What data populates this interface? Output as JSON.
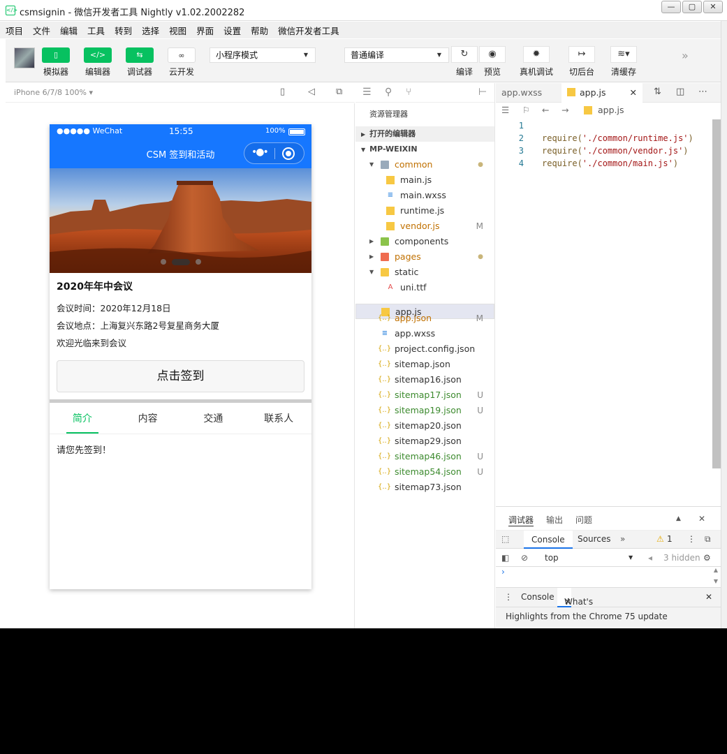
{
  "window": {
    "title": "csmsignin - 微信开发者工具 Nightly v1.02.2002282"
  },
  "menu": [
    "项目",
    "文件",
    "编辑",
    "工具",
    "转到",
    "选择",
    "视图",
    "界面",
    "设置",
    "帮助",
    "微信开发者工具"
  ],
  "toolbar": {
    "simulator": "模拟器",
    "editor": "编辑器",
    "debugger": "调试器",
    "cloud": "云开发",
    "mode": "小程序模式",
    "compile_mode": "普通编译",
    "compile": "编译",
    "preview": "预览",
    "remote_debug": "真机调试",
    "background": "切后台",
    "clear_cache": "清缓存"
  },
  "simulator": {
    "device": "iPhone 6/7/8 100% ▾"
  },
  "phone": {
    "carrier": "●●●●● WeChat",
    "time": "15:55",
    "battery": "100%",
    "nav_title": "CSM 签到和活动",
    "meeting_title": "2020年年中会议",
    "meeting_time": "会议时间：2020年12月18日",
    "meeting_place": "会议地点：上海复兴东路2号复星商务大厦",
    "welcome": "欢迎光临来到会议",
    "sign_button": "点击签到",
    "tabs": [
      "简介",
      "内容",
      "交通",
      "联系人"
    ],
    "active_tab": 0,
    "tab_content": "请您先签到！"
  },
  "explorer": {
    "header": "资源管理器",
    "open_editors": "打开的编辑器",
    "project": "MP-WEIXIN",
    "files": [
      {
        "name": "common",
        "type": "folder",
        "depth": 0,
        "open": true,
        "badge": "●",
        "color": "orange"
      },
      {
        "name": "main.js",
        "type": "js",
        "depth": 1,
        "badge": "",
        "color": ""
      },
      {
        "name": "main.wxss",
        "type": "wxss",
        "depth": 1,
        "badge": "",
        "color": ""
      },
      {
        "name": "runtime.js",
        "type": "js",
        "depth": 1,
        "badge": "",
        "color": ""
      },
      {
        "name": "vendor.js",
        "type": "js",
        "depth": 1,
        "badge": "M",
        "color": "orange"
      },
      {
        "name": "components",
        "type": "folder",
        "depth": 0,
        "open": false,
        "badge": "",
        "color": ""
      },
      {
        "name": "pages",
        "type": "folder",
        "depth": 0,
        "open": false,
        "badge": "●",
        "color": "orange"
      },
      {
        "name": "static",
        "type": "folder",
        "depth": 0,
        "open": true,
        "badge": "",
        "color": ""
      },
      {
        "name": "uni.ttf",
        "type": "ttf",
        "depth": 1,
        "badge": "",
        "color": ""
      },
      {
        "name": "app.js",
        "type": "js",
        "depth": 0,
        "badge": "",
        "color": "",
        "selected": true
      },
      {
        "name": "app.json",
        "type": "json",
        "depth": 0,
        "badge": "M",
        "color": "orange"
      },
      {
        "name": "app.wxss",
        "type": "wxss",
        "depth": 0,
        "badge": "",
        "color": ""
      },
      {
        "name": "project.config.json",
        "type": "json",
        "depth": 0,
        "badge": "",
        "color": ""
      },
      {
        "name": "sitemap.json",
        "type": "json",
        "depth": 0,
        "badge": "",
        "color": ""
      },
      {
        "name": "sitemap16.json",
        "type": "json",
        "depth": 0,
        "badge": "",
        "color": ""
      },
      {
        "name": "sitemap17.json",
        "type": "json",
        "depth": 0,
        "badge": "U",
        "color": "green"
      },
      {
        "name": "sitemap19.json",
        "type": "json",
        "depth": 0,
        "badge": "U",
        "color": "green"
      },
      {
        "name": "sitemap20.json",
        "type": "json",
        "depth": 0,
        "badge": "",
        "color": ""
      },
      {
        "name": "sitemap29.json",
        "type": "json",
        "depth": 0,
        "badge": "",
        "color": ""
      },
      {
        "name": "sitemap46.json",
        "type": "json",
        "depth": 0,
        "badge": "U",
        "color": "green"
      },
      {
        "name": "sitemap54.json",
        "type": "json",
        "depth": 0,
        "badge": "U",
        "color": "green"
      },
      {
        "name": "sitemap73.json",
        "type": "json",
        "depth": 0,
        "badge": "",
        "color": ""
      }
    ]
  },
  "editor": {
    "tabs": [
      "app.wxss",
      "app.js"
    ],
    "active_tab": "app.js",
    "breadcrumb": "app.js",
    "lines": [
      {
        "n": "1",
        "code": ""
      },
      {
        "n": "2",
        "code": "require('./common/runtime.js')"
      },
      {
        "n": "3",
        "code": "require('./common/vendor.js')"
      },
      {
        "n": "4",
        "code": "require('./common/main.js')"
      }
    ]
  },
  "devtools": {
    "panel_tabs": [
      "调试器",
      "输出",
      "问题"
    ],
    "tabs": [
      "Console",
      "Sources"
    ],
    "warnings": "1",
    "context": "top",
    "hidden": "3 hidden",
    "drawer_tabs": [
      "Console",
      "What's New"
    ],
    "whats_new": "Highlights from the Chrome 75 update"
  },
  "colors": {
    "accent": "#07c160",
    "nav_blue": "#1677ff"
  }
}
